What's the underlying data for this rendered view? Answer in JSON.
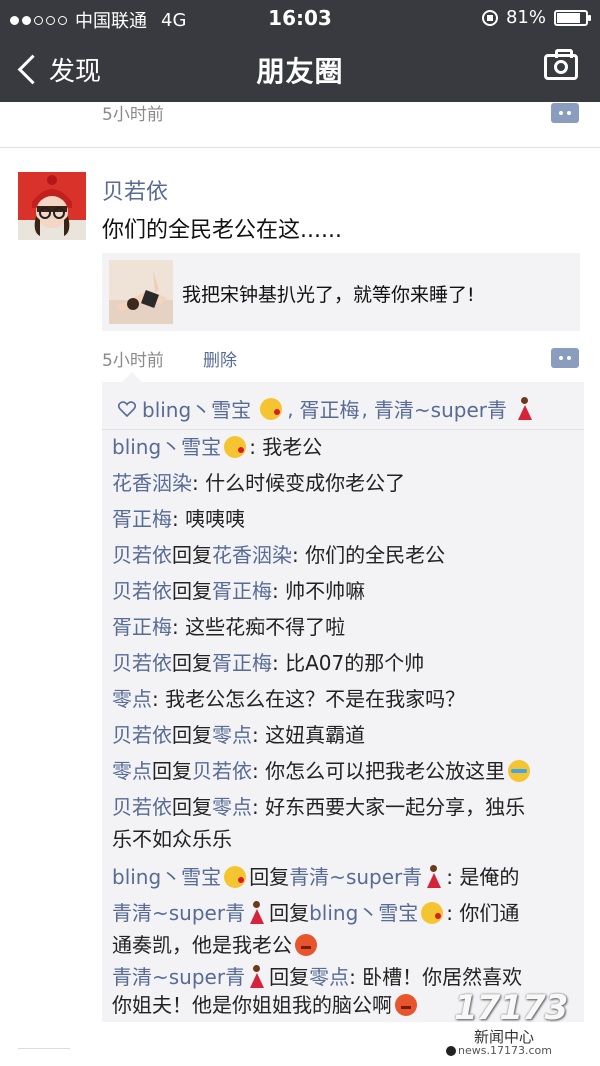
{
  "status_bar": {
    "carrier": "中国联通",
    "network": "4G",
    "time": "16:03",
    "battery": "81%",
    "battery_level": 0.81
  },
  "nav": {
    "back_label": "发现",
    "title": "朋友圈"
  },
  "previous_post": {
    "time": "5小时前"
  },
  "post": {
    "author": "贝若依",
    "text": "你们的全民老公在这......",
    "share_text": "我把宋钟基扒光了，就等你来睡了!",
    "time": "5小时前",
    "delete_label": "删除",
    "likes": {
      "user1": "bling丶雪宝",
      "sep1": ",",
      "user2": "胥正梅",
      "sep2": ",",
      "user3": "青清~super青"
    },
    "comments": [
      {
        "from": "bling丶雪宝",
        "reply_word": "",
        "to": "",
        "colon": ":",
        "text": " 我老公"
      },
      {
        "from": "花香洇染",
        "reply_word": "",
        "to": "",
        "colon": ":",
        "text": " 什么时候变成你老公了"
      },
      {
        "from": "胥正梅",
        "reply_word": "",
        "to": "",
        "colon": ":",
        "text": " 咦咦咦"
      },
      {
        "from": "贝若依",
        "reply_word": "回复",
        "to": "花香洇染",
        "colon": ":",
        "text": " 你们的全民老公"
      },
      {
        "from": "贝若依",
        "reply_word": "回复",
        "to": "胥正梅",
        "colon": ":",
        "text": " 帅不帅嘛"
      },
      {
        "from": "胥正梅",
        "reply_word": "",
        "to": "",
        "colon": ":",
        "text": " 这些花痴不得了啦"
      },
      {
        "from": "贝若依",
        "reply_word": "回复",
        "to": "胥正梅",
        "colon": ":",
        "text": " 比A07的那个帅"
      },
      {
        "from": "零点",
        "reply_word": "",
        "to": "",
        "colon": ":",
        "text": " 我老公怎么在这？不是在我家吗？"
      },
      {
        "from": "贝若依",
        "reply_word": "回复",
        "to": "零点",
        "colon": ":",
        "text": " 这妞真霸道"
      },
      {
        "from": "零点",
        "reply_word": "回复",
        "to": "贝若依",
        "colon": ":",
        "text": " 你怎么可以把我老公放这里"
      },
      {
        "from": "贝若依",
        "reply_word": "回复",
        "to": "零点",
        "colon": ":",
        "text": " 好东西要大家一起分享，独乐",
        "text2": "乐不如众乐乐"
      },
      {
        "from": "bling丶雪宝",
        "reply_word": "回复",
        "to": "青清~super青",
        "colon": ":",
        "text": " 是俺的"
      },
      {
        "from": "青清~super青",
        "reply_word": "回复",
        "to": "bling丶雪宝",
        "colon": ":",
        "text": " 你们通",
        "text2": "通奏凯，他是我老公"
      },
      {
        "from": "青清~super青",
        "reply_word": "回复",
        "to": "零点",
        "colon": ":",
        "text": " 卧槽！你居然喜欢",
        "text2": "你姐夫！他是你姐姐我的脑公啊"
      }
    ]
  },
  "watermark": {
    "logo": "17173",
    "label": "新闻中心",
    "url": "news.17173.com"
  },
  "colors": {
    "header_bg": "#393a3f",
    "link": "#576b95",
    "comment_bg": "#f3f3f5"
  },
  "icons": [
    "signal-dots-icon",
    "rotation-lock-icon",
    "battery-icon",
    "back-chevron-icon",
    "camera-icon",
    "comment-action-icon",
    "heart-icon",
    "kiss-emoji-icon",
    "dancer-emoji-icon",
    "crying-emoji-icon",
    "angry-emoji-icon"
  ]
}
